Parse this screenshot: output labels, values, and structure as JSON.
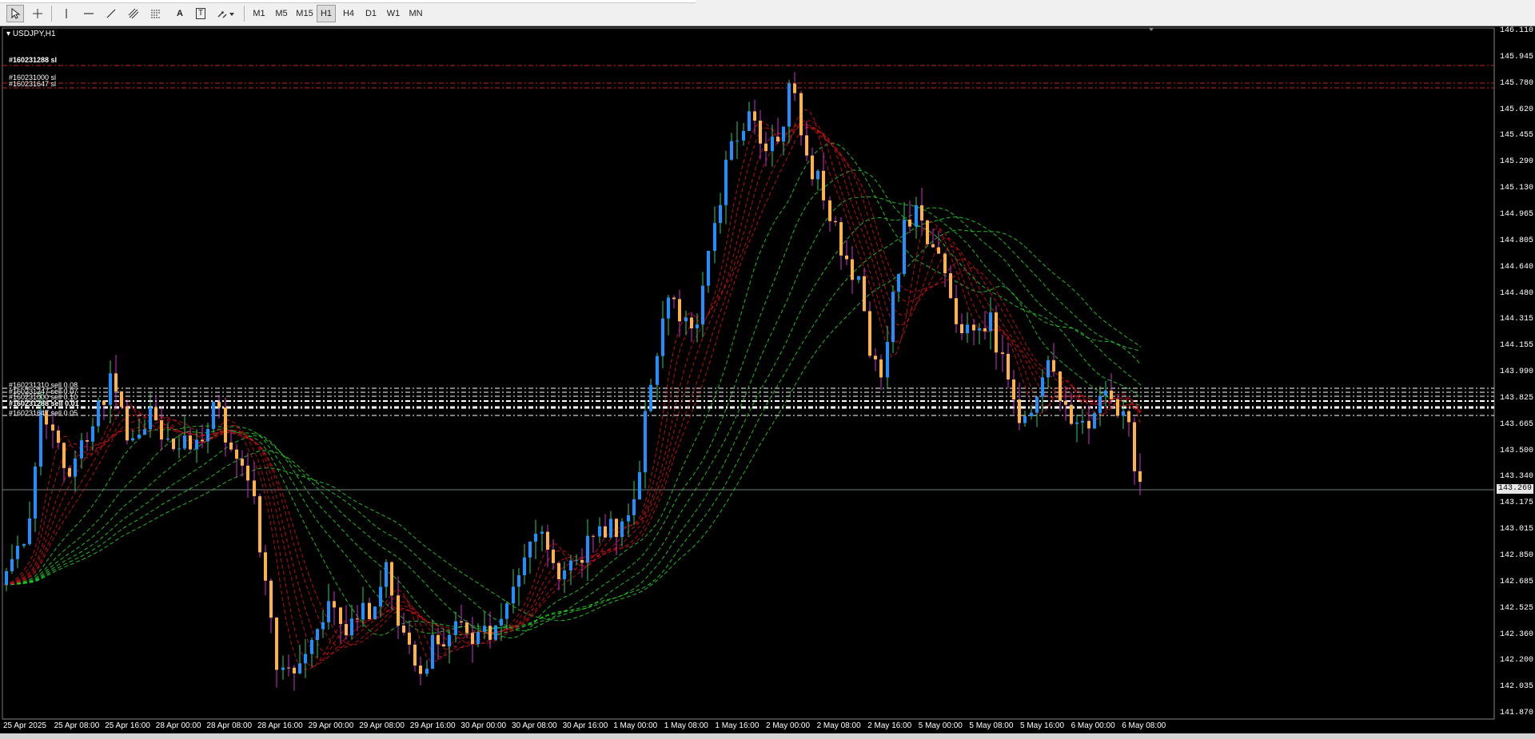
{
  "toolbar": {
    "tools": [
      {
        "name": "cursor-tool",
        "icon": "cursor-icon"
      },
      {
        "name": "crosshair-tool",
        "icon": "crosshair-icon"
      },
      {
        "name": "vertical-line-tool",
        "icon": "vertical-line-icon"
      },
      {
        "name": "horizontal-line-tool",
        "icon": "horizontal-line-icon"
      },
      {
        "name": "trendline-tool",
        "icon": "trendline-icon"
      },
      {
        "name": "equidistant-channel-tool",
        "icon": "channel-icon"
      },
      {
        "name": "fibonacci-tool",
        "icon": "fibonacci-icon"
      },
      {
        "name": "text-tool",
        "icon": "text-icon",
        "label": "A"
      },
      {
        "name": "text-label-tool",
        "icon": "text-label-icon",
        "label": "T"
      },
      {
        "name": "arrows-tool",
        "icon": "arrows-icon"
      }
    ],
    "timeframes": [
      "M1",
      "M5",
      "M15",
      "H1",
      "H4",
      "D1",
      "W1",
      "MN"
    ],
    "active_timeframe": "H1"
  },
  "chart": {
    "symbol": "USDJPY,H1",
    "current_price": "143.269",
    "price_labels": [
      "146.110",
      "145.945",
      "145.780",
      "145.620",
      "145.455",
      "145.290",
      "145.130",
      "144.965",
      "144.805",
      "144.640",
      "144.480",
      "144.315",
      "144.155",
      "143.990",
      "143.825",
      "143.665",
      "143.500",
      "143.340",
      "143.175",
      "143.015",
      "142.850",
      "142.685",
      "142.525",
      "142.360",
      "142.200",
      "142.035",
      "141.870"
    ],
    "time_labels": [
      "25 Apr 2025",
      "25 Apr 08:00",
      "25 Apr 16:00",
      "28 Apr 00:00",
      "28 Apr 08:00",
      "28 Apr 16:00",
      "29 Apr 00:00",
      "29 Apr 08:00",
      "29 Apr 16:00",
      "30 Apr 00:00",
      "30 Apr 08:00",
      "30 Apr 16:00",
      "1 May 00:00",
      "1 May 08:00",
      "1 May 16:00",
      "2 May 00:00",
      "2 May 08:00",
      "2 May 16:00",
      "5 May 00:00",
      "5 May 08:00",
      "5 May 16:00",
      "6 May 00:00",
      "6 May 08:00"
    ],
    "sl_labels": [
      "#160231288 sl",
      "#160231000 sl",
      "#160231647 sl"
    ],
    "order_labels": [
      "#160231310 sell 0.08",
      "#160231247 sell 0.07",
      "#160231000 sell 0.10",
      "#160231288 sell 0.01",
      "#160231647 sell 0.05"
    ],
    "colors": {
      "background": "#000000",
      "bull_candle": "#1e90ff",
      "bear_candle": "#ffb347",
      "bear_wick": "#cc33cc",
      "ma_fast": "#cc1111",
      "ma_slow": "#22cc22",
      "sl_line": "#cc2222",
      "order_line": "#ffffff"
    }
  }
}
